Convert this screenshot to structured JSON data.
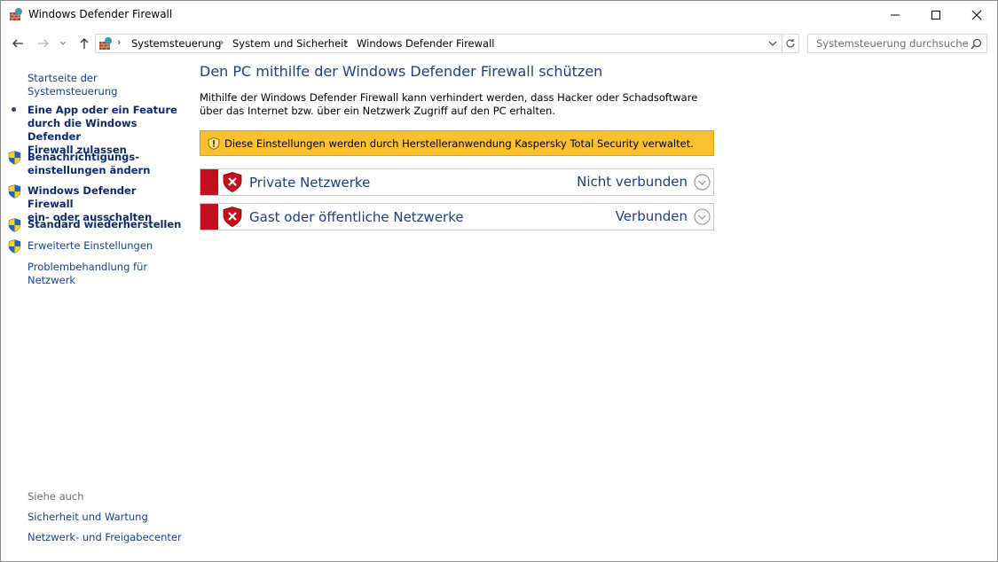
{
  "window": {
    "title": "Windows Defender Firewall",
    "icons": {
      "app": "firewall-brick-globe-icon",
      "minimize": "minimize-icon",
      "maximize": "maximize-icon",
      "close": "close-icon"
    }
  },
  "nav": {
    "back": "back-arrow-icon",
    "forward": "forward-arrow-icon",
    "recent": "chevron-down-icon",
    "up": "up-arrow-icon",
    "breadcrumb": [
      "Systemsteuerung",
      "System und Sicherheit",
      "Windows Defender Firewall"
    ],
    "search_placeholder": "Systemsteuerung durchsuchen"
  },
  "sidebar": {
    "home_link": "Startseite der Systemsteuerung",
    "items": [
      {
        "label_line1": "Eine App oder ein Feature",
        "label_line2": "durch die Windows Defender",
        "label_line3": "Firewall zulassen",
        "icon": "bullet"
      },
      {
        "label_line1": "Benachrichtigungs-",
        "label_line2": "einstellungen ändern",
        "icon": "uac-shield-icon"
      },
      {
        "label_line1": "Windows Defender Firewall",
        "label_line2": "ein- oder ausschalten",
        "icon": "uac-shield-icon"
      },
      {
        "label_line1": "Standard wiederherstellen",
        "icon": "uac-shield-icon"
      },
      {
        "label_line1": "Erweiterte Einstellungen",
        "icon": "uac-shield-icon"
      },
      {
        "label_line1": "Problembehandlung für",
        "label_line2": "Netzwerk"
      }
    ],
    "see_also": {
      "heading": "Siehe auch",
      "links": [
        "Sicherheit und Wartung",
        "Netzwerk- und Freigabecenter"
      ]
    }
  },
  "main": {
    "title": "Den PC mithilfe der Windows Defender Firewall schützen",
    "description": "Mithilfe der Windows Defender Firewall kann verhindert werden, dass Hacker oder Schadsoftware über das Internet bzw. über ein Netzwerk Zugriff auf den PC erhalten.",
    "warning": "Diese Einstellungen werden durch Herstelleranwendung Kaspersky Total Security verwaltet.",
    "networks": [
      {
        "name": "Private Netzwerke",
        "status": "Nicht verbunden"
      },
      {
        "name": "Gast oder öffentliche Netzwerke",
        "status": "Verbunden"
      }
    ]
  },
  "colors": {
    "accent_link": "#1a3f93",
    "title": "#1e3c8c",
    "warning_bg": "#fbc02d",
    "status_red": "#c50f1f"
  }
}
